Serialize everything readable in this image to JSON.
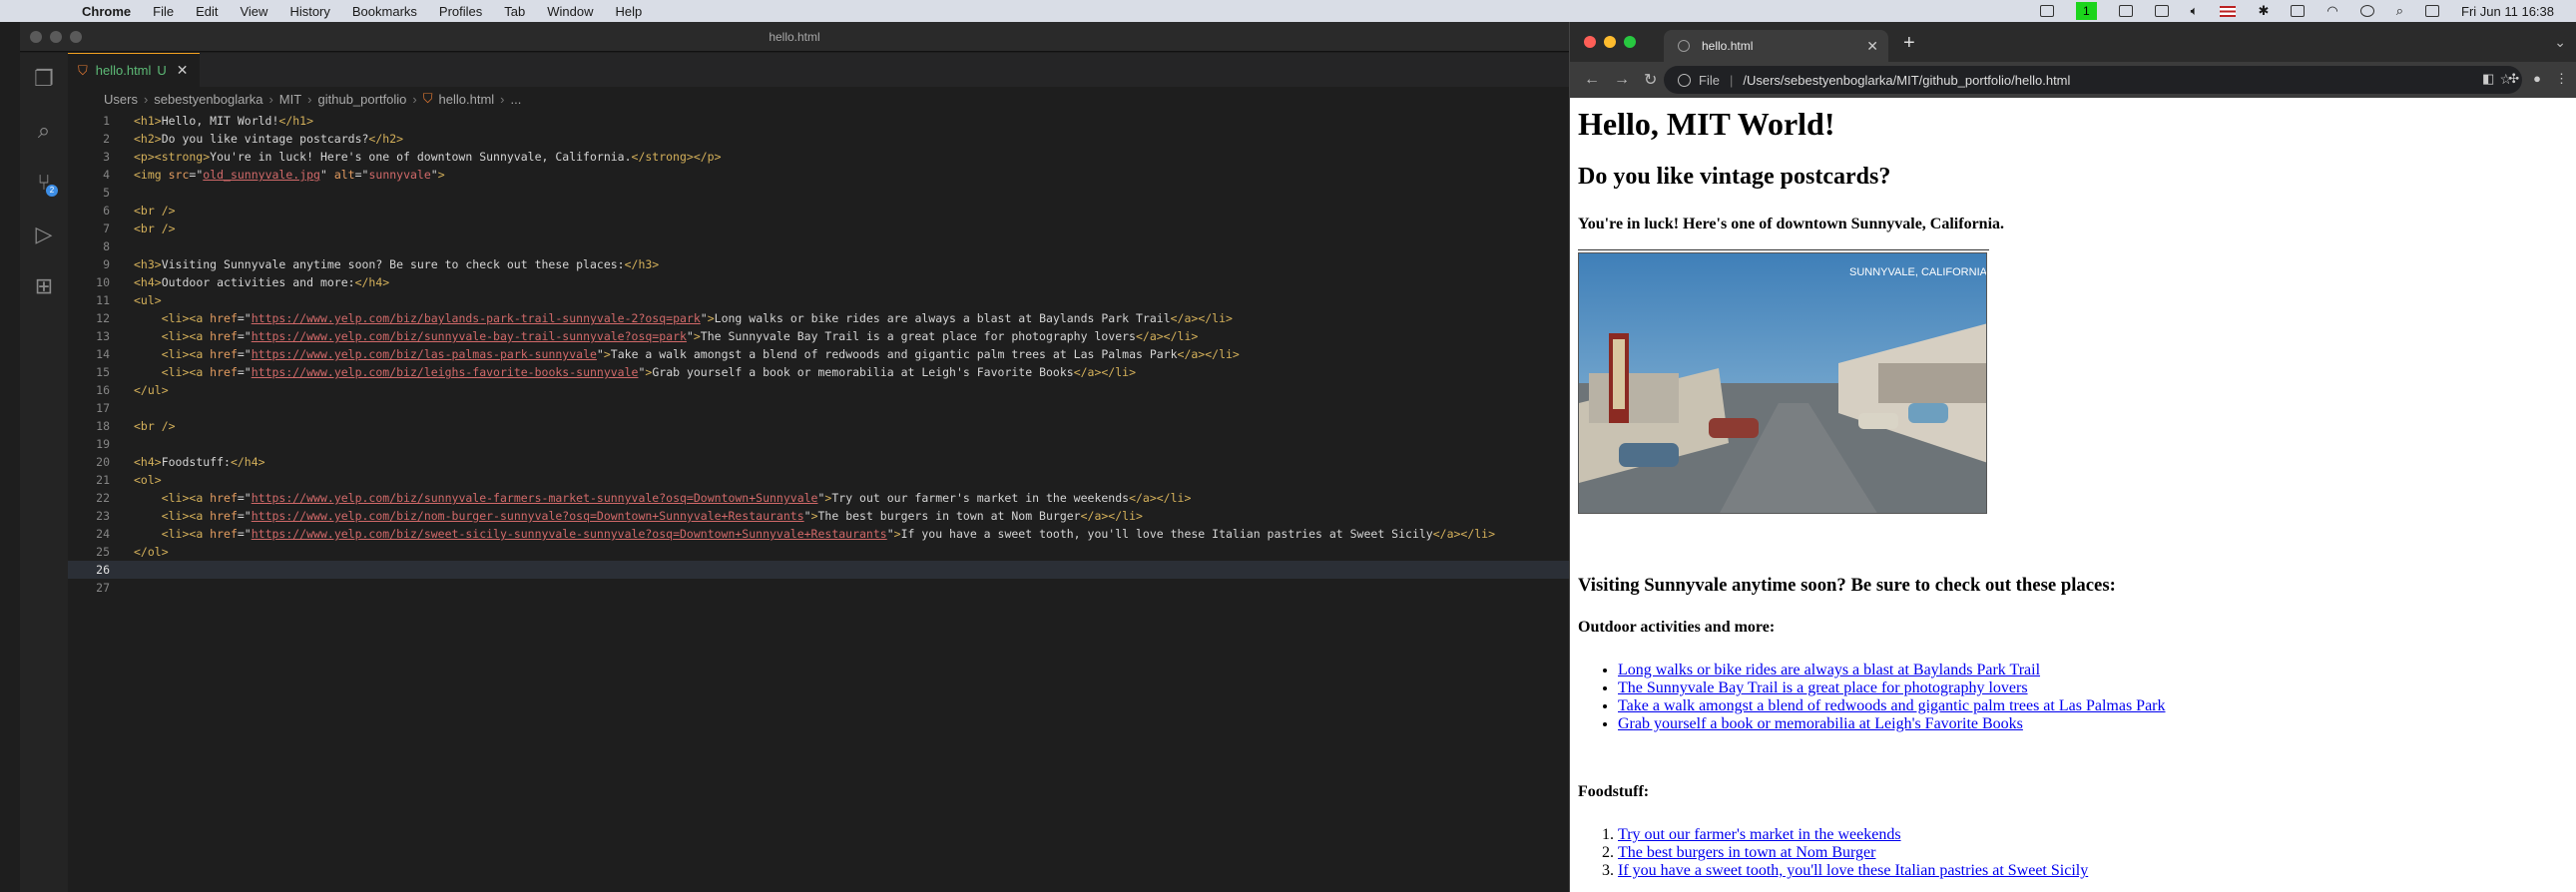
{
  "menubar": {
    "app": "Chrome",
    "menus": [
      "File",
      "Edit",
      "View",
      "History",
      "Bookmarks",
      "Profiles",
      "Tab",
      "Window",
      "Help"
    ],
    "badge": "1",
    "clock": "Fri Jun 11  16:38"
  },
  "vscode": {
    "window_title": "hello.html",
    "tab": {
      "name": "hello.html",
      "status": "U"
    },
    "breadcrumbs": [
      "Users",
      "sebestyenboglarka",
      "MIT",
      "github_portfolio",
      "hello.html",
      "..."
    ],
    "scm_badge": "2",
    "current_line": 26,
    "lines": [
      {
        "n": "1",
        "parts": [
          [
            "tg",
            "<h1>"
          ],
          [
            "tx",
            "Hello, MIT World!"
          ],
          [
            "tg",
            "</h1>"
          ]
        ]
      },
      {
        "n": "2",
        "parts": [
          [
            "tg",
            "<h2>"
          ],
          [
            "tx",
            "Do you like vintage postcards?"
          ],
          [
            "tg",
            "</h2>"
          ]
        ]
      },
      {
        "n": "3",
        "parts": [
          [
            "tg",
            "<p><strong>"
          ],
          [
            "tx",
            "You're in luck! Here's one of downtown Sunnyvale, California."
          ],
          [
            "tg",
            "</strong></p>"
          ]
        ]
      },
      {
        "n": "4",
        "parts": [
          [
            "tg",
            "<img "
          ],
          [
            "at",
            "src"
          ],
          [
            "tx",
            "=\""
          ],
          [
            "svu",
            "old_sunnyvale.jpg"
          ],
          [
            "tx",
            "\" "
          ],
          [
            "at",
            "alt"
          ],
          [
            "tx",
            "=\""
          ],
          [
            "sv",
            "sunnyvale"
          ],
          [
            "tx",
            "\""
          ],
          [
            "tg",
            ">"
          ]
        ]
      },
      {
        "n": "5",
        "parts": []
      },
      {
        "n": "6",
        "parts": [
          [
            "tg",
            "<br />"
          ]
        ]
      },
      {
        "n": "7",
        "parts": [
          [
            "tg",
            "<br />"
          ]
        ]
      },
      {
        "n": "8",
        "parts": []
      },
      {
        "n": "9",
        "parts": [
          [
            "tg",
            "<h3>"
          ],
          [
            "tx",
            "Visiting Sunnyvale anytime soon? Be sure to check out these places:"
          ],
          [
            "tg",
            "</h3>"
          ]
        ]
      },
      {
        "n": "10",
        "parts": [
          [
            "tg",
            "<h4>"
          ],
          [
            "tx",
            "Outdoor activities and more:"
          ],
          [
            "tg",
            "</h4>"
          ]
        ]
      },
      {
        "n": "11",
        "parts": [
          [
            "tg",
            "<ul>"
          ]
        ]
      },
      {
        "n": "12",
        "parts": [
          [
            "tx",
            "    "
          ],
          [
            "tg",
            "<li><a "
          ],
          [
            "at",
            "href"
          ],
          [
            "tx",
            "=\""
          ],
          [
            "svu",
            "https://www.yelp.com/biz/baylands-park-trail-sunnyvale-2?osq=park"
          ],
          [
            "tx",
            "\""
          ],
          [
            "tg",
            ">"
          ],
          [
            "tx",
            "Long walks or bike rides are always a blast at Baylands Park Trail"
          ],
          [
            "tg",
            "</a></li>"
          ]
        ]
      },
      {
        "n": "13",
        "parts": [
          [
            "tx",
            "    "
          ],
          [
            "tg",
            "<li><a "
          ],
          [
            "at",
            "href"
          ],
          [
            "tx",
            "=\""
          ],
          [
            "svu",
            "https://www.yelp.com/biz/sunnyvale-bay-trail-sunnyvale?osq=park"
          ],
          [
            "tx",
            "\""
          ],
          [
            "tg",
            ">"
          ],
          [
            "tx",
            "The Sunnyvale Bay Trail is a great place for photography lovers"
          ],
          [
            "tg",
            "</a></li>"
          ]
        ]
      },
      {
        "n": "14",
        "parts": [
          [
            "tx",
            "    "
          ],
          [
            "tg",
            "<li><a "
          ],
          [
            "at",
            "href"
          ],
          [
            "tx",
            "=\""
          ],
          [
            "svu",
            "https://www.yelp.com/biz/las-palmas-park-sunnyvale"
          ],
          [
            "tx",
            "\""
          ],
          [
            "tg",
            ">"
          ],
          [
            "tx",
            "Take a walk amongst a blend of redwoods and gigantic palm trees at Las Palmas Park"
          ],
          [
            "tg",
            "</a></li>"
          ]
        ]
      },
      {
        "n": "15",
        "parts": [
          [
            "tx",
            "    "
          ],
          [
            "tg",
            "<li><a "
          ],
          [
            "at",
            "href"
          ],
          [
            "tx",
            "=\""
          ],
          [
            "svu",
            "https://www.yelp.com/biz/leighs-favorite-books-sunnyvale"
          ],
          [
            "tx",
            "\""
          ],
          [
            "tg",
            ">"
          ],
          [
            "tx",
            "Grab yourself a book or memorabilia at Leigh's Favorite Books"
          ],
          [
            "tg",
            "</a></li>"
          ]
        ]
      },
      {
        "n": "16",
        "parts": [
          [
            "tg",
            "</ul>"
          ]
        ]
      },
      {
        "n": "17",
        "parts": []
      },
      {
        "n": "18",
        "parts": [
          [
            "tg",
            "<br />"
          ]
        ]
      },
      {
        "n": "19",
        "parts": []
      },
      {
        "n": "20",
        "parts": [
          [
            "tg",
            "<h4>"
          ],
          [
            "tx",
            "Foodstuff:"
          ],
          [
            "tg",
            "</h4>"
          ]
        ]
      },
      {
        "n": "21",
        "parts": [
          [
            "tg",
            "<ol>"
          ]
        ]
      },
      {
        "n": "22",
        "parts": [
          [
            "tx",
            "    "
          ],
          [
            "tg",
            "<li><a "
          ],
          [
            "at",
            "href"
          ],
          [
            "tx",
            "=\""
          ],
          [
            "svu",
            "https://www.yelp.com/biz/sunnyvale-farmers-market-sunnyvale?osq=Downtown+Sunnyvale"
          ],
          [
            "tx",
            "\""
          ],
          [
            "tg",
            ">"
          ],
          [
            "tx",
            "Try out our farmer's market in the weekends"
          ],
          [
            "tg",
            "</a></li>"
          ]
        ]
      },
      {
        "n": "23",
        "parts": [
          [
            "tx",
            "    "
          ],
          [
            "tg",
            "<li><a "
          ],
          [
            "at",
            "href"
          ],
          [
            "tx",
            "=\""
          ],
          [
            "svu",
            "https://www.yelp.com/biz/nom-burger-sunnyvale?osq=Downtown+Sunnyvale+Restaurants"
          ],
          [
            "tx",
            "\""
          ],
          [
            "tg",
            ">"
          ],
          [
            "tx",
            "The best burgers in town at Nom Burger"
          ],
          [
            "tg",
            "</a></li>"
          ]
        ]
      },
      {
        "n": "24",
        "parts": [
          [
            "tx",
            "    "
          ],
          [
            "tg",
            "<li><a "
          ],
          [
            "at",
            "href"
          ],
          [
            "tx",
            "=\""
          ],
          [
            "svu",
            "https://www.yelp.com/biz/sweet-sicily-sunnyvale-sunnyvale?osq=Downtown+Sunnyvale+Restaurants"
          ],
          [
            "tx",
            "\""
          ],
          [
            "tg",
            ">"
          ],
          [
            "tx",
            "If you have a sweet tooth, you'll love these Italian pastries at Sweet Sicily"
          ],
          [
            "tg",
            "</a></li>"
          ]
        ]
      },
      {
        "n": "25",
        "parts": [
          [
            "tg",
            "</ol>"
          ]
        ]
      },
      {
        "n": "26",
        "parts": []
      },
      {
        "n": "27",
        "parts": []
      }
    ]
  },
  "chrome": {
    "tab_title": "hello.html",
    "url_scheme": "File",
    "url": "/Users/sebestyenboglarka/MIT/github_portfolio/hello.html",
    "page": {
      "h1": "Hello, MIT World!",
      "h2": "Do you like vintage postcards?",
      "p": "You're in luck! Here's one of downtown Sunnyvale, California.",
      "postcard_caption": "SUNNYVALE, CALIFORNIA",
      "h3": "Visiting Sunnyvale anytime soon? Be sure to check out these places:",
      "h4_outdoor": "Outdoor activities and more:",
      "outdoor": [
        "Long walks or bike rides are always a blast at Baylands Park Trail",
        "The Sunnyvale Bay Trail is a great place for photography lovers",
        "Take a walk amongst a blend of redwoods and gigantic palm trees at Las Palmas Park",
        "Grab yourself a book or memorabilia at Leigh's Favorite Books"
      ],
      "h4_food": "Foodstuff:",
      "food": [
        "Try out our farmer's market in the weekends",
        "The best burgers in town at Nom Burger",
        "If you have a sweet tooth, you'll love these Italian pastries at Sweet Sicily"
      ]
    }
  },
  "colors": {
    "link": "#0000ee",
    "vscode_tab_accent": "#f0a020",
    "scm_badge": "#3d8ee6"
  }
}
